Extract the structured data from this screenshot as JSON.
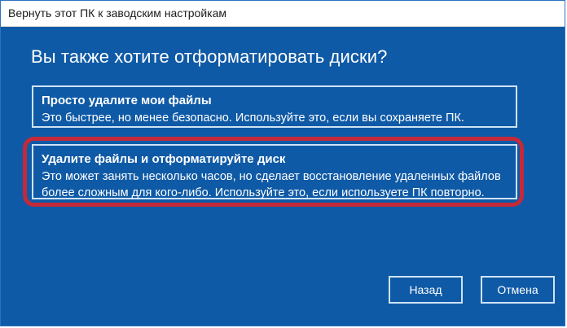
{
  "window": {
    "title": "Вернуть этот ПК к заводским настройкам"
  },
  "main": {
    "question": "Вы также хотите отформатировать диски?",
    "options": [
      {
        "title": "Просто удалите мои файлы",
        "description": "Это быстрее, но менее безопасно. Используйте это, если вы сохраняете ПК."
      },
      {
        "title": "Удалите файлы и отформатируйте диск",
        "description_line1": "Это может занять несколько часов, но сделает восстановление удаленных файлов",
        "description_line2": "более сложным для кого-либо. Используйте это, если используете ПК повторно."
      }
    ]
  },
  "buttons": {
    "back_label": "Назад",
    "cancel_label": "Отмена"
  },
  "colors": {
    "background": "#0f5aa6",
    "option_border": "#cfe2f5",
    "highlight": "#c42a3a"
  }
}
